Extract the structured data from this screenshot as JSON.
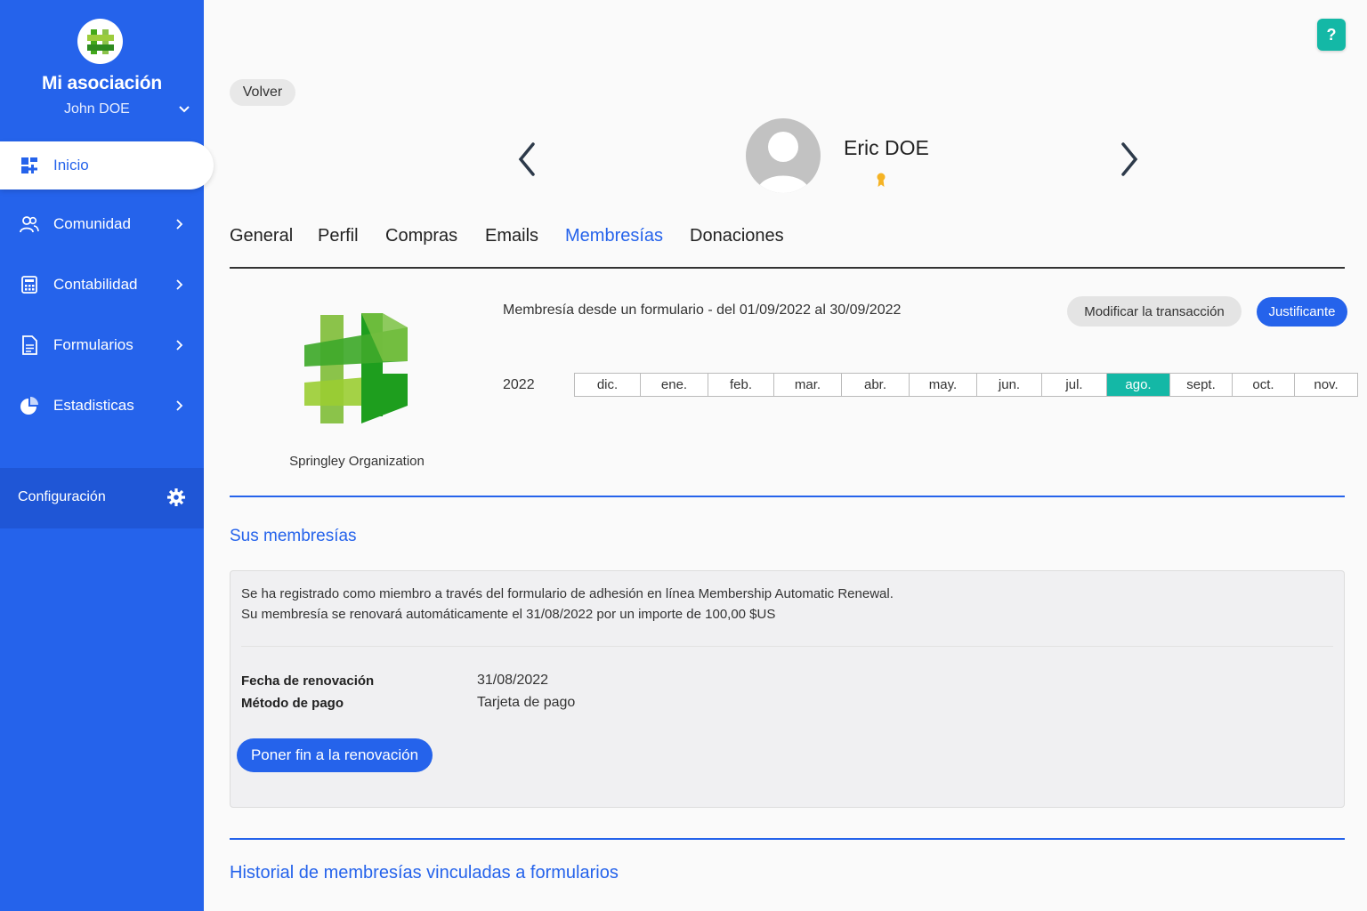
{
  "sidebar": {
    "org_name": "Mi asociación",
    "user_name": "John DOE",
    "items": [
      {
        "label": "Inicio",
        "icon": "dashboard-icon"
      },
      {
        "label": "Comunidad",
        "icon": "users-icon"
      },
      {
        "label": "Contabilidad",
        "icon": "calculator-icon"
      },
      {
        "label": "Formularios",
        "icon": "document-icon"
      },
      {
        "label": "Estadisticas",
        "icon": "pie-chart-icon"
      }
    ],
    "config_label": "Configuración"
  },
  "header": {
    "help_label": "?",
    "back_label": "Volver",
    "profile_name": "Eric DOE"
  },
  "tabs": [
    {
      "label": "General"
    },
    {
      "label": "Perfil"
    },
    {
      "label": "Compras"
    },
    {
      "label": "Emails"
    },
    {
      "label": "Membresías"
    },
    {
      "label": "Donaciones"
    }
  ],
  "membership": {
    "org_caption": "Springley Organization",
    "description": "Membresía desde un formulario - del 01/09/2022 al 30/09/2022",
    "modify_label": "Modificar la transacción",
    "receipt_label": "Justificante",
    "year": "2022",
    "months": [
      "dic.",
      "ene.",
      "feb.",
      "mar.",
      "abr.",
      "may.",
      "jun.",
      "jul.",
      "ago.",
      "sept.",
      "oct.",
      "nov."
    ],
    "active_month": "ago."
  },
  "your_memberships": {
    "title": "Sus membresías",
    "line1": "Se ha registrado como miembro a través del formulario de adhesión en línea Membership Automatic Renewal.",
    "line2": "Su membresía se renovará automáticamente el 31/08/2022 por un importe de 100,00 $US",
    "renewal_key": "Fecha de renovación",
    "renewal_value": "31/08/2022",
    "payment_key": "Método de pago",
    "payment_value": "Tarjeta de pago",
    "stop_label": "Poner fin a la renovación"
  },
  "history": {
    "title": "Historial de membresías vinculadas a formularios"
  },
  "colors": {
    "primary": "#2563eb",
    "teal": "#14b8a6"
  }
}
